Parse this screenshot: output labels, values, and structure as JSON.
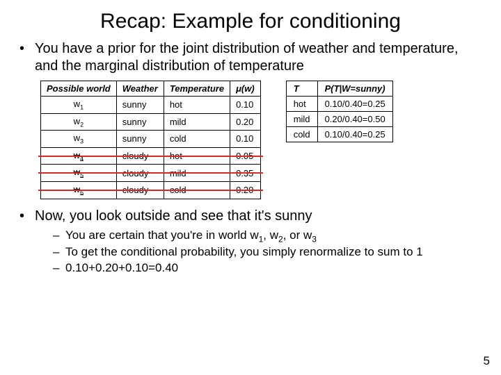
{
  "title": "Recap: Example for conditioning",
  "bullet1": "You have a prior for the joint distribution of weather and temperature, and the marginal distribution of temperature",
  "bullet2": "Now, you look outside and see that it's sunny",
  "sub1": "You are certain that you're in world w",
  "sub1_tail": ", w",
  "sub1_tail2": ", or w",
  "sub2": "To get the conditional probability, you simply renormalize to sum to 1",
  "sub3": "0.10+0.20+0.10=0.40",
  "pagenum": "5",
  "table1": {
    "headers": [
      "Possible world",
      "Weather",
      "Temperature",
      "μ(w)"
    ],
    "rows": [
      {
        "w": "w",
        "sub": "1",
        "weather": "sunny",
        "temp": "hot",
        "mu": "0.10",
        "struck": false
      },
      {
        "w": "w",
        "sub": "2",
        "weather": "sunny",
        "temp": "mild",
        "mu": "0.20",
        "struck": false
      },
      {
        "w": "w",
        "sub": "3",
        "weather": "sunny",
        "temp": "cold",
        "mu": "0.10",
        "struck": false
      },
      {
        "w": "w",
        "sub": "4",
        "weather": "cloudy",
        "temp": "hot",
        "mu": "0.05",
        "struck": true
      },
      {
        "w": "w",
        "sub": "5",
        "weather": "cloudy",
        "temp": "mild",
        "mu": "0.35",
        "struck": true
      },
      {
        "w": "w",
        "sub": "6",
        "weather": "cloudy",
        "temp": "cold",
        "mu": "0.20",
        "struck": true
      }
    ]
  },
  "table2": {
    "headers": [
      "T",
      "P(T|W=sunny)"
    ],
    "rows": [
      {
        "t": "hot",
        "p": "0.10/0.40=0.25"
      },
      {
        "t": "mild",
        "p": "0.20/0.40=0.50"
      },
      {
        "t": "cold",
        "p": "0.10/0.40=0.25"
      }
    ]
  }
}
